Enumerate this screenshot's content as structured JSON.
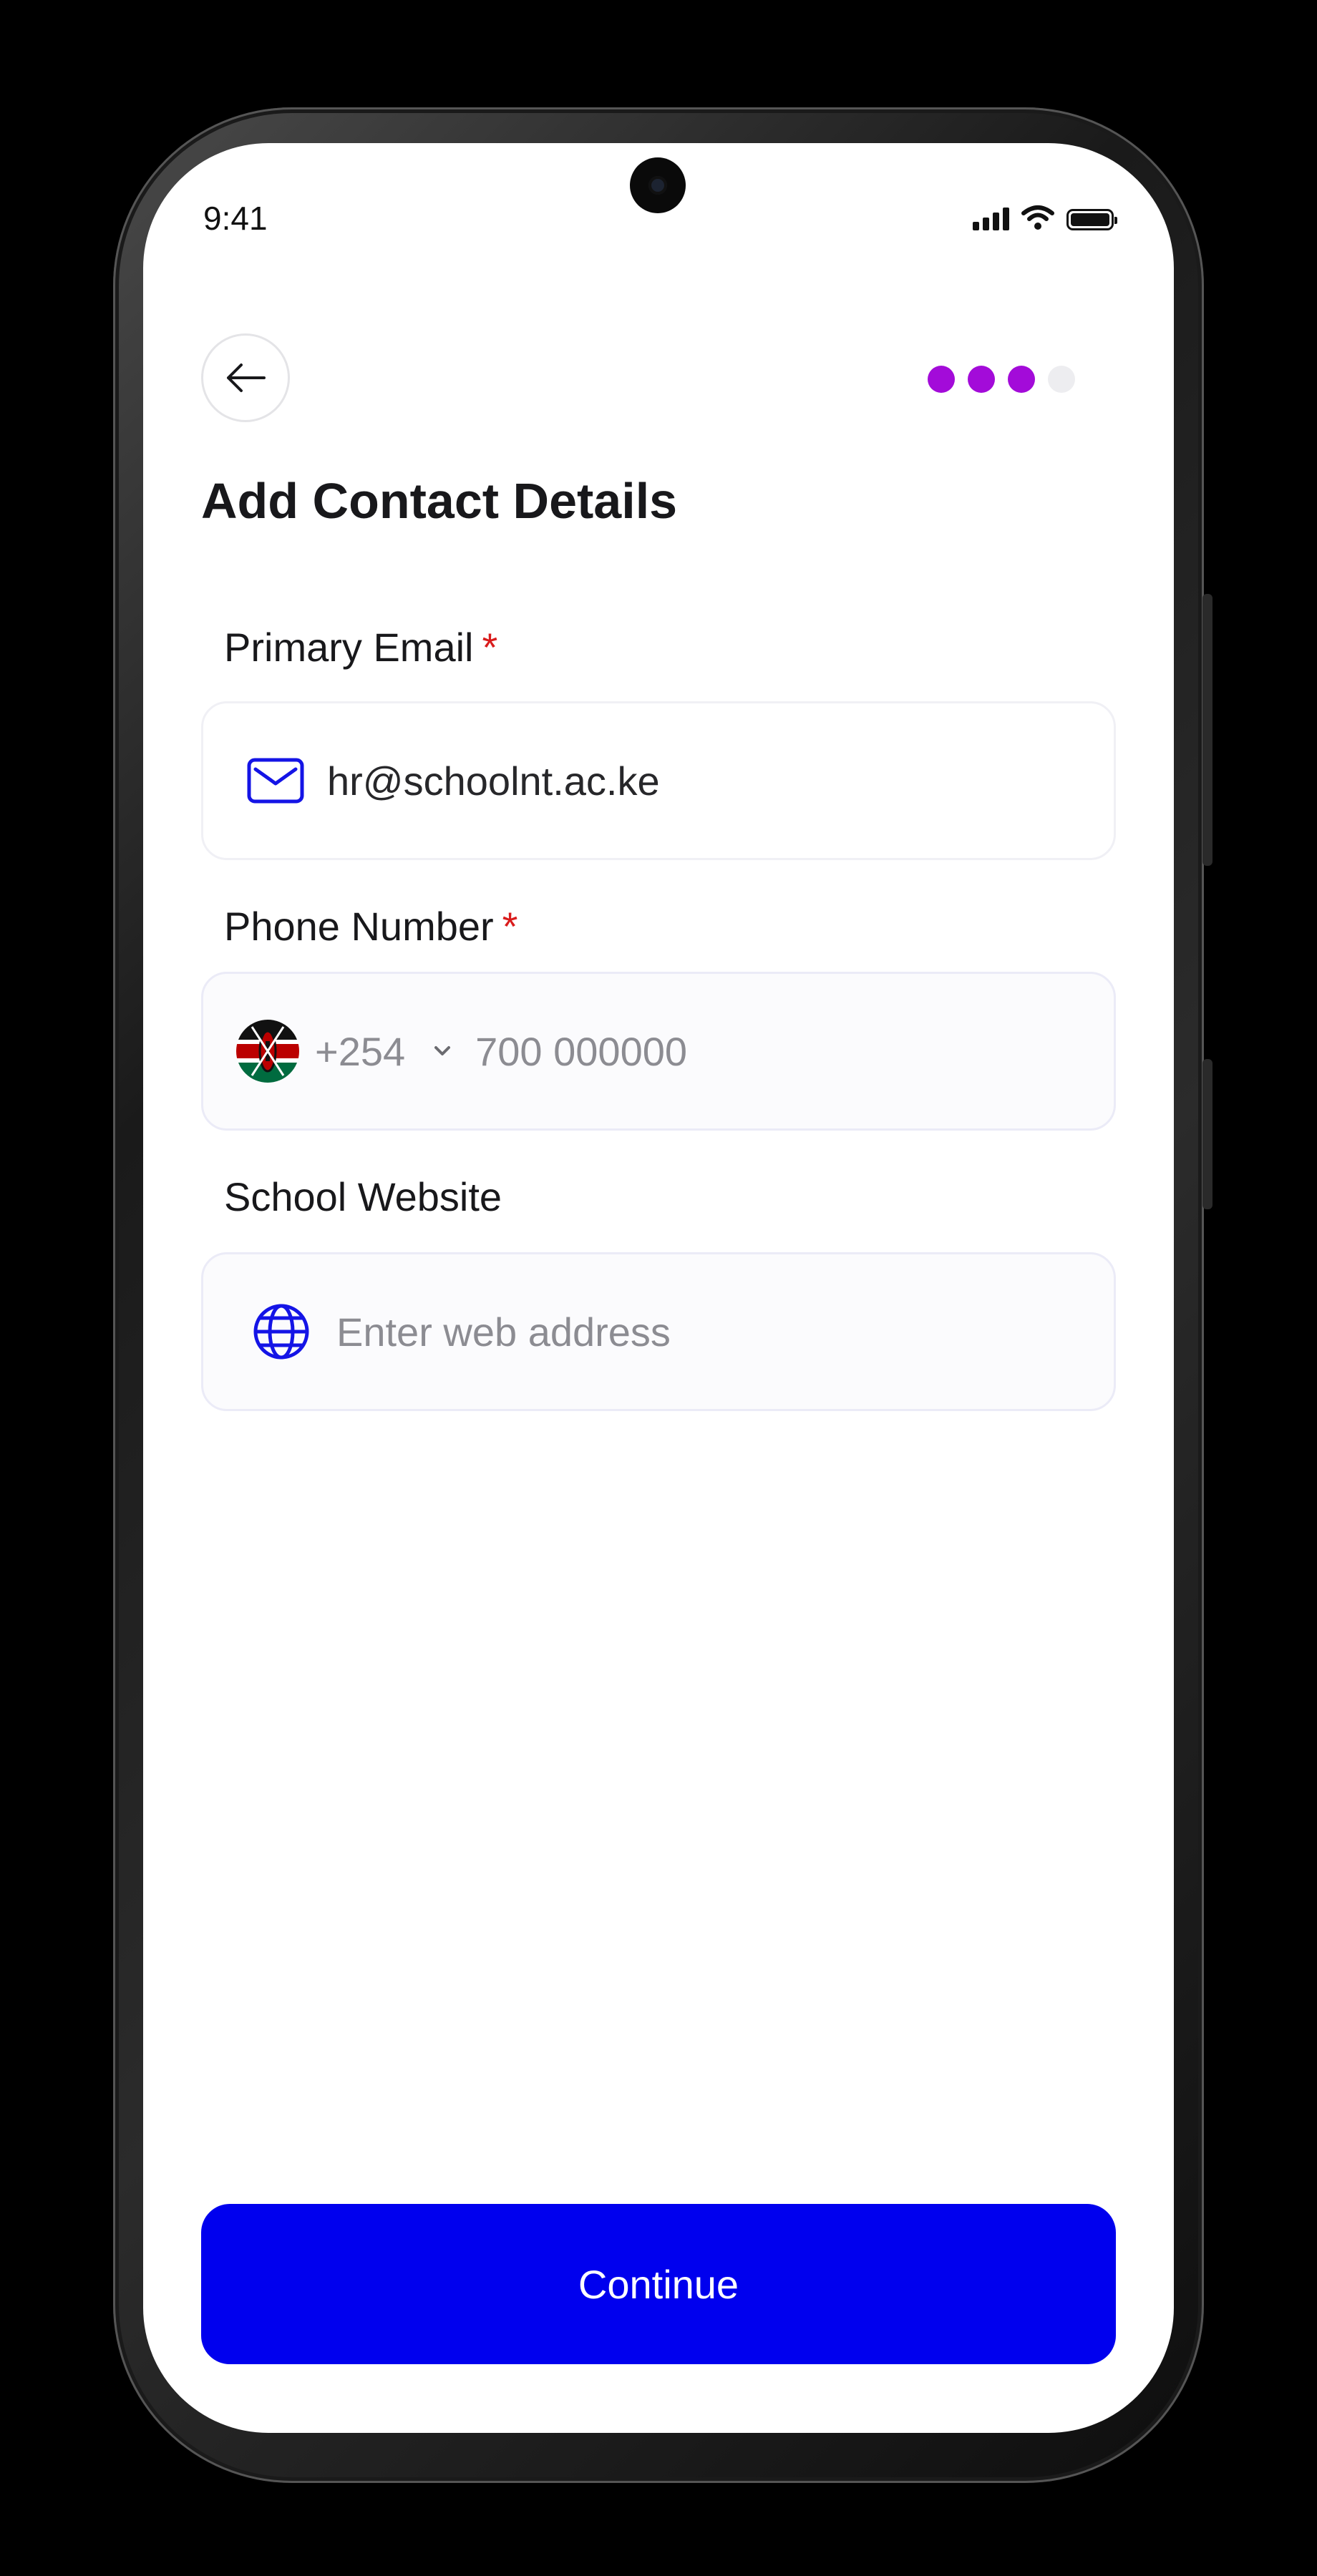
{
  "status_bar": {
    "time": "9:41"
  },
  "progress": {
    "total_steps": 4,
    "completed_steps": 3,
    "active_color": "#a30bd9",
    "inactive_color": "#ededf0"
  },
  "page": {
    "title": "Add Contact Details"
  },
  "form": {
    "email": {
      "label": "Primary Email",
      "required_mark": "*",
      "value": "hr@schoolnt.ac.ke",
      "icon": "mail-icon"
    },
    "phone": {
      "label": "Phone Number",
      "required_mark": "*",
      "country_code": "+254",
      "placeholder": "700 000000",
      "flag": "kenya-flag-icon"
    },
    "website": {
      "label": "School Website",
      "placeholder": "Enter web address",
      "icon": "globe-icon"
    }
  },
  "actions": {
    "continue_label": "Continue",
    "button_color": "#0000ee"
  }
}
